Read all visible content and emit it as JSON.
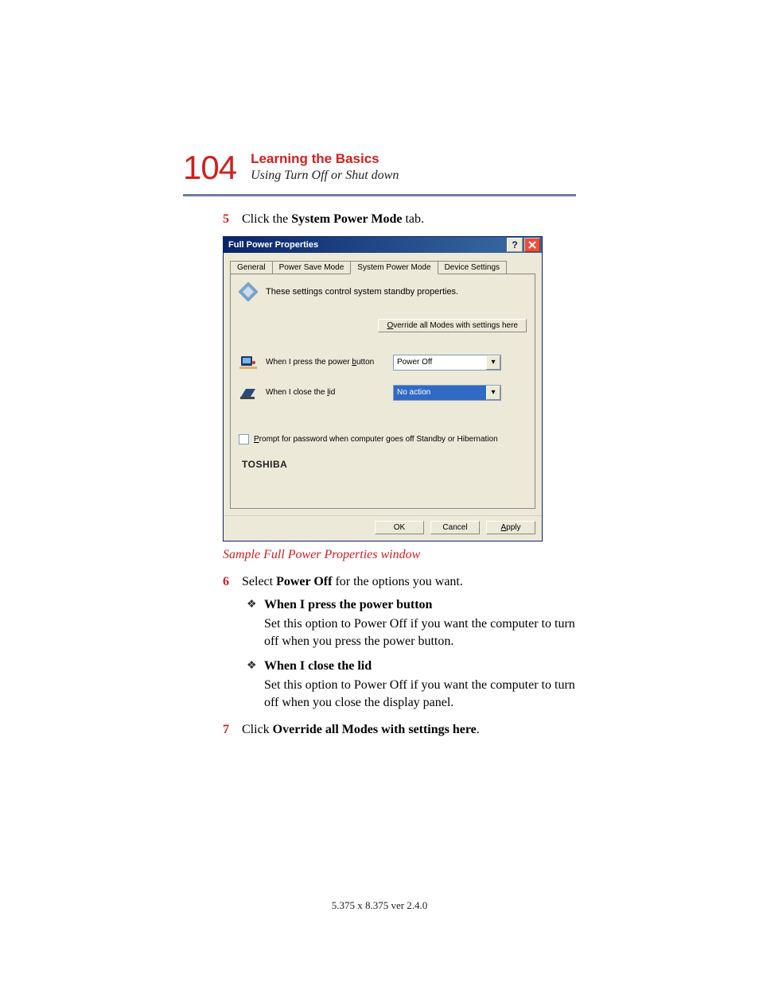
{
  "header": {
    "page_number": "104",
    "chapter": "Learning the Basics",
    "section": "Using Turn Off or Shut down"
  },
  "steps": {
    "s5": {
      "num": "5",
      "text_pre": "Click the ",
      "bold": "System Power Mode",
      "text_post": " tab."
    },
    "s6": {
      "num": "6",
      "text_pre": "Select ",
      "bold": "Power Off",
      "text_post": " for the options you want."
    },
    "s7": {
      "num": "7",
      "text_pre": "Click ",
      "bold": "Override all Modes with settings here",
      "text_post": "."
    }
  },
  "bullets": {
    "b1": {
      "label": "When I press the power button",
      "desc": "Set this option to Power Off if you want the computer to turn off when you press the power button."
    },
    "b2": {
      "label": "When I close the lid",
      "desc": "Set this option to Power Off if you want the computer to turn off when you close the display panel."
    }
  },
  "caption": "Sample Full Power Properties window",
  "dialog": {
    "title": "Full Power Properties",
    "tabs": [
      "General",
      "Power Save Mode",
      "System Power Mode",
      "Device Settings"
    ],
    "desc": "These settings control system standby properties.",
    "override_btn": "Override all Modes with settings here",
    "opt1_label": "When I press the power button",
    "opt1_value": "Power Off",
    "opt2_label": "When I close the lid",
    "opt2_value": "No action",
    "checkbox_label": "Prompt for password when computer goes off Standby or Hibernation",
    "brand": "TOSHIBA",
    "ok": "OK",
    "cancel": "Cancel",
    "apply": "Apply"
  },
  "footer": "5.375 x 8.375 ver 2.4.0"
}
